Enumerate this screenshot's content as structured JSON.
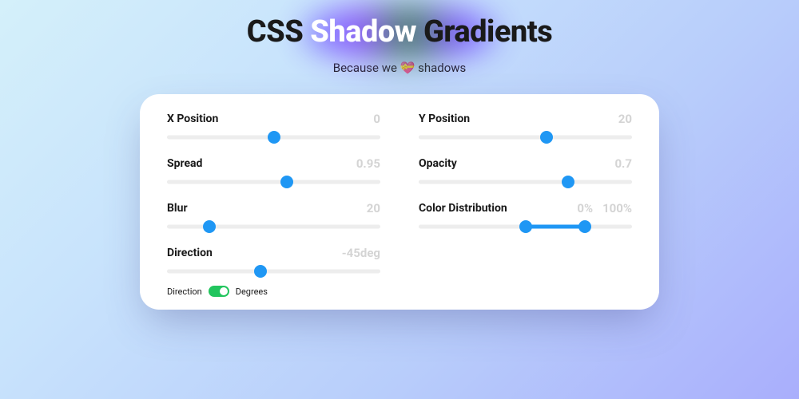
{
  "title": {
    "part1": "CSS ",
    "highlight": "Shadow",
    "part2": " Gradients"
  },
  "subtitle_prefix": "Because we ",
  "subtitle_emoji": "💝",
  "subtitle_suffix": " shadows",
  "controls": {
    "x_position": {
      "label": "X Position",
      "value": "0",
      "pct": 50
    },
    "y_position": {
      "label": "Y Position",
      "value": "20",
      "pct": 60
    },
    "spread": {
      "label": "Spread",
      "value": "0.95",
      "pct": 56
    },
    "opacity": {
      "label": "Opacity",
      "value": "0.7",
      "pct": 70
    },
    "blur": {
      "label": "Blur",
      "value": "20",
      "pct": 20
    },
    "color_dist": {
      "label": "Color Distribution",
      "low": "0%",
      "high": "100%",
      "lowPct": 50,
      "highPct": 78
    },
    "direction": {
      "label": "Direction",
      "value": "-45deg",
      "pct": 44
    }
  },
  "toggle": {
    "left": "Direction",
    "right": "Degrees",
    "on": true
  }
}
